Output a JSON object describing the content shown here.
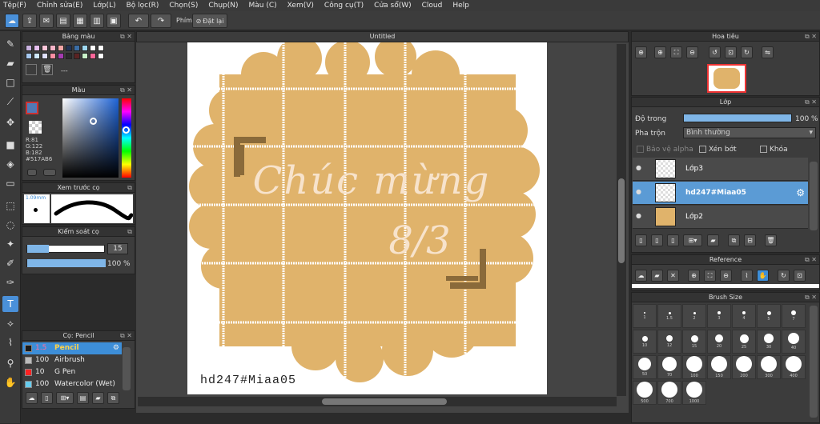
{
  "menu": [
    "Tệp(F)",
    "Chỉnh sửa(E)",
    "Lớp(L)",
    "Bộ lọc(R)",
    "Chọn(S)",
    "Chụp(N)",
    "Màu (C)",
    "Xem(V)",
    "Công cụ(T)",
    "Cửa sổ(W)",
    "Cloud",
    "Help"
  ],
  "toolbar": {
    "shortcut_label": "Phím",
    "reset_label": "Đặt lại"
  },
  "palette": {
    "title": "Bảng màu",
    "dash": "---",
    "colors": [
      "#c9b2e0",
      "#e7c0f0",
      "#ffc6d9",
      "#f7b4c8",
      "#f4a6a6",
      "#223355",
      "#3b6ea5",
      "#9fd8f0",
      "#ffffff",
      "#ffffff",
      "#a6c8f0",
      "#cfe8ff",
      "#e0e0ff",
      "#ff8fa3",
      "#a33bb0",
      "#2a2a2a",
      "#5a2323",
      "#c8f0c8",
      "#ff6699",
      "#ffffff"
    ]
  },
  "color_panel": {
    "title": "Màu",
    "r": "R:81",
    "g": "G:122",
    "b": "B:182",
    "hex": "#517AB6",
    "current": "#517AB6"
  },
  "brush_preview": {
    "title": "Xem trước cọ",
    "size": "1.09mm"
  },
  "brush_control": {
    "title": "Kiểm soát cọ",
    "size_value": "15",
    "opacity_value": "100 %",
    "size_fraction": 0.28,
    "opacity_fraction": 1.0
  },
  "brush_list": {
    "title": "Cọ: Pencil",
    "items": [
      {
        "size": "1.5",
        "name": "Pencil",
        "color": "#1a1a1a",
        "selected": true
      },
      {
        "size": "100",
        "name": "Airbrush",
        "color": "#bbbbbb",
        "selected": false
      },
      {
        "size": "10",
        "name": "G Pen",
        "color": "#ff2222",
        "selected": false
      },
      {
        "size": "100",
        "name": "Watercolor (Wet)",
        "color": "#66ccee",
        "selected": false
      }
    ]
  },
  "canvas": {
    "tab_title": "Untitled",
    "main_text_line1": "Chúc mừng",
    "main_text_line2": "8/3",
    "watermark": "hd247#Miaa05"
  },
  "navigator": {
    "title": "Hoa tiêu"
  },
  "layer_panel": {
    "title": "Lớp",
    "opacity_label": "Độ trong",
    "opacity_value": "100 %",
    "opacity_fraction": 1.0,
    "blend_label": "Pha trộn",
    "blend_value": "Bình thường",
    "protect_alpha": "Bảo vệ alpha",
    "clip": "Xén bớt",
    "lock": "Khóa",
    "layers": [
      {
        "name": "Lớp3",
        "selected": false
      },
      {
        "name": "hd247#Miaa05",
        "selected": true
      },
      {
        "name": "Lớp2",
        "selected": false
      }
    ]
  },
  "reference": {
    "title": "Reference"
  },
  "brush_size": {
    "title": "Brush Size",
    "sizes": [
      "1",
      "1.5",
      "2",
      "3",
      "4",
      "5",
      "7",
      "10",
      "12",
      "15",
      "20",
      "25",
      "30",
      "40",
      "50",
      "70",
      "100",
      "150",
      "200",
      "300",
      "400",
      "500",
      "700",
      "1000"
    ]
  }
}
